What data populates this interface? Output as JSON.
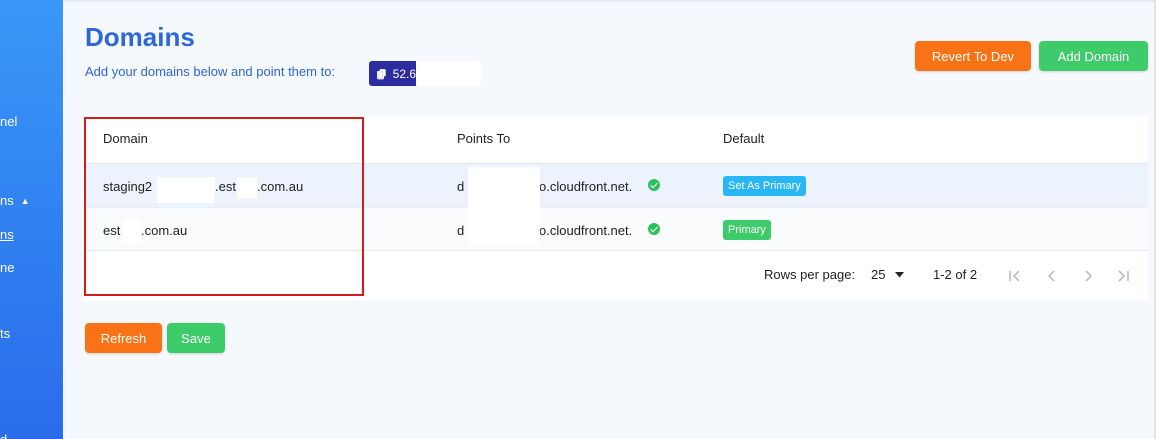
{
  "sidebar": {
    "items": [
      {
        "label": "nel"
      },
      {
        "label": "ns"
      },
      {
        "label": "ns"
      },
      {
        "label": "ne"
      },
      {
        "label": "ts"
      },
      {
        "label": "d"
      }
    ]
  },
  "header": {
    "title": "Domains",
    "subtitle": "Add your domains below and point them to:",
    "ip_prefix": "52.6",
    "revert_label": "Revert To Dev",
    "add_label": "Add Domain"
  },
  "table": {
    "columns": [
      "Domain",
      "Points To",
      "Default"
    ],
    "rows": [
      {
        "domain_a": "staging2",
        "domain_b": ".est",
        "domain_c": ".com.au",
        "points_a": "d",
        "points_b": "o.cloudfront.net.",
        "default": "Set As Primary"
      },
      {
        "domain_a": "est",
        "domain_b": "",
        "domain_c": ".com.au",
        "points_a": "d",
        "points_b": "o.cloudfront.net.",
        "default": "Primary"
      }
    ],
    "pager": {
      "rows_per_page_label": "Rows per page:",
      "rows_per_page": "25",
      "range": "1-2 of 2"
    }
  },
  "footer": {
    "refresh_label": "Refresh",
    "save_label": "Save"
  },
  "colors": {
    "accent": "#2f66d8",
    "orange": "#f97316",
    "green": "#3ecb6a",
    "badge_blue": "#29b6f6",
    "highlight": "#d01c1c"
  }
}
